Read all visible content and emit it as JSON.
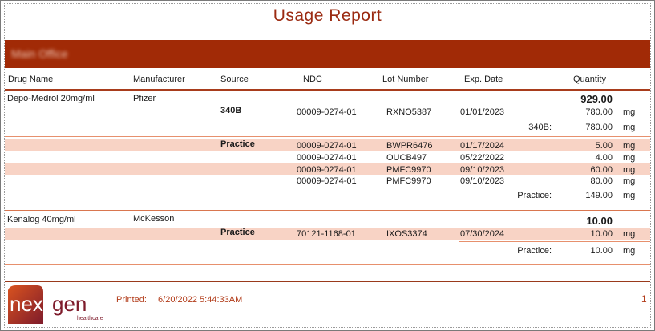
{
  "report": {
    "title": "Usage Report",
    "location": "Main Office"
  },
  "columns": {
    "drug_name": "Drug Name",
    "manufacturer": "Manufacturer",
    "source": "Source",
    "ndc": "NDC",
    "lot_number": "Lot Number",
    "exp_date": "Exp. Date",
    "quantity": "Quantity"
  },
  "drugs": [
    {
      "name": "Depo-Medrol 20mg/ml",
      "manufacturer": "Pfizer",
      "total": "929.00",
      "groups": [
        {
          "source": "340B",
          "rows": [
            {
              "ndc": "00009-0274-01",
              "lot": "RXNO5387",
              "exp": "01/01/2023",
              "qty": "780.00",
              "unit": "mg"
            }
          ],
          "subtotal_label": "340B:",
          "subtotal": "780.00",
          "subtotal_unit": "mg"
        },
        {
          "source": "Practice",
          "rows": [
            {
              "ndc": "00009-0274-01",
              "lot": "BWPR6476",
              "exp": "01/17/2024",
              "qty": "5.00",
              "unit": "mg"
            },
            {
              "ndc": "00009-0274-01",
              "lot": "OUCB497",
              "exp": "05/22/2022",
              "qty": "4.00",
              "unit": "mg"
            },
            {
              "ndc": "00009-0274-01",
              "lot": "PMFC9970",
              "exp": "09/10/2023",
              "qty": "60.00",
              "unit": "mg"
            },
            {
              "ndc": "00009-0274-01",
              "lot": "PMFC9970",
              "exp": "09/10/2023",
              "qty": "80.00",
              "unit": "mg"
            }
          ],
          "subtotal_label": "Practice:",
          "subtotal": "149.00",
          "subtotal_unit": "mg"
        }
      ]
    },
    {
      "name": "Kenalog 40mg/ml",
      "manufacturer": "McKesson",
      "total": "10.00",
      "groups": [
        {
          "source": "Practice",
          "rows": [
            {
              "ndc": "70121-1168-01",
              "lot": "IXOS3374",
              "exp": "07/30/2024",
              "qty": "10.00",
              "unit": "mg"
            }
          ],
          "subtotal_label": "Practice:",
          "subtotal": "10.00",
          "subtotal_unit": "mg"
        }
      ]
    }
  ],
  "footer": {
    "printed_label": "Printed:",
    "printed_value": "6/20/2022 5:44:33AM",
    "page_number": "1"
  },
  "logo": {
    "text_next": "next",
    "text_gen": "gen",
    "subtext": "healthcare",
    "color_primary": "#c0441c",
    "color_secondary": "#8a1f2a"
  }
}
